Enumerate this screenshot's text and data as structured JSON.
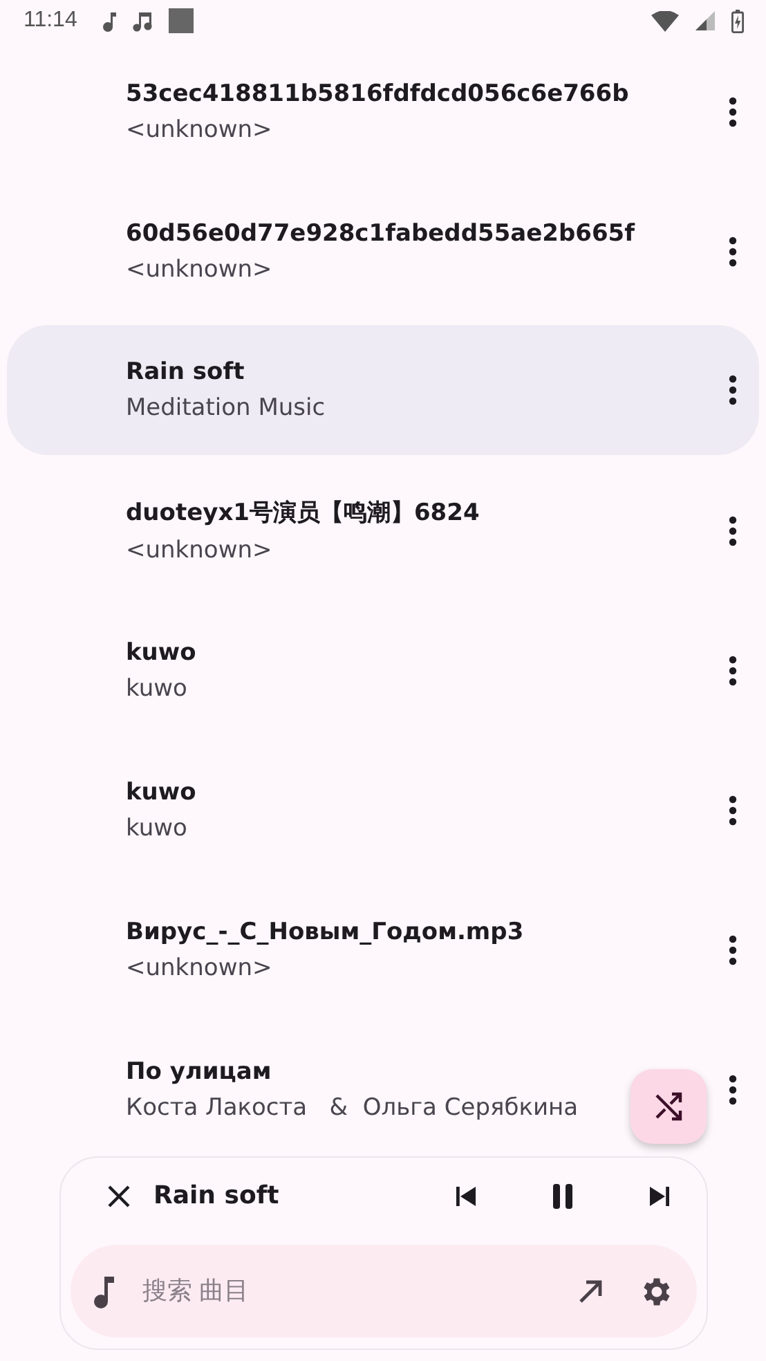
{
  "status_bar": {
    "time": "11:14"
  },
  "tracks": [
    {
      "title": "53cec418811b5816fdfdcd056c6e766b",
      "artist": "<unknown>",
      "selected": false
    },
    {
      "title": "60d56e0d77e928c1fabedd55ae2b665f",
      "artist": "<unknown>",
      "selected": false
    },
    {
      "title": "Rain soft",
      "artist": "Meditation Music",
      "selected": true
    },
    {
      "title": "duoteyx1号演员【鸣潮】6824",
      "artist": "<unknown>",
      "selected": false
    },
    {
      "title": "kuwo",
      "artist": "kuwo",
      "selected": false
    },
    {
      "title": "kuwo",
      "artist": "kuwo",
      "selected": false
    },
    {
      "title": "Вирус_-_С_Новым_Годом.mp3",
      "artist": "<unknown>",
      "selected": false
    },
    {
      "title": "По улицам",
      "artist": "Коста Лакоста   &  Ольга Серябкина",
      "selected": false
    }
  ],
  "player": {
    "title": "Rain soft",
    "playing": true
  },
  "search": {
    "placeholder": "搜索 曲目"
  }
}
